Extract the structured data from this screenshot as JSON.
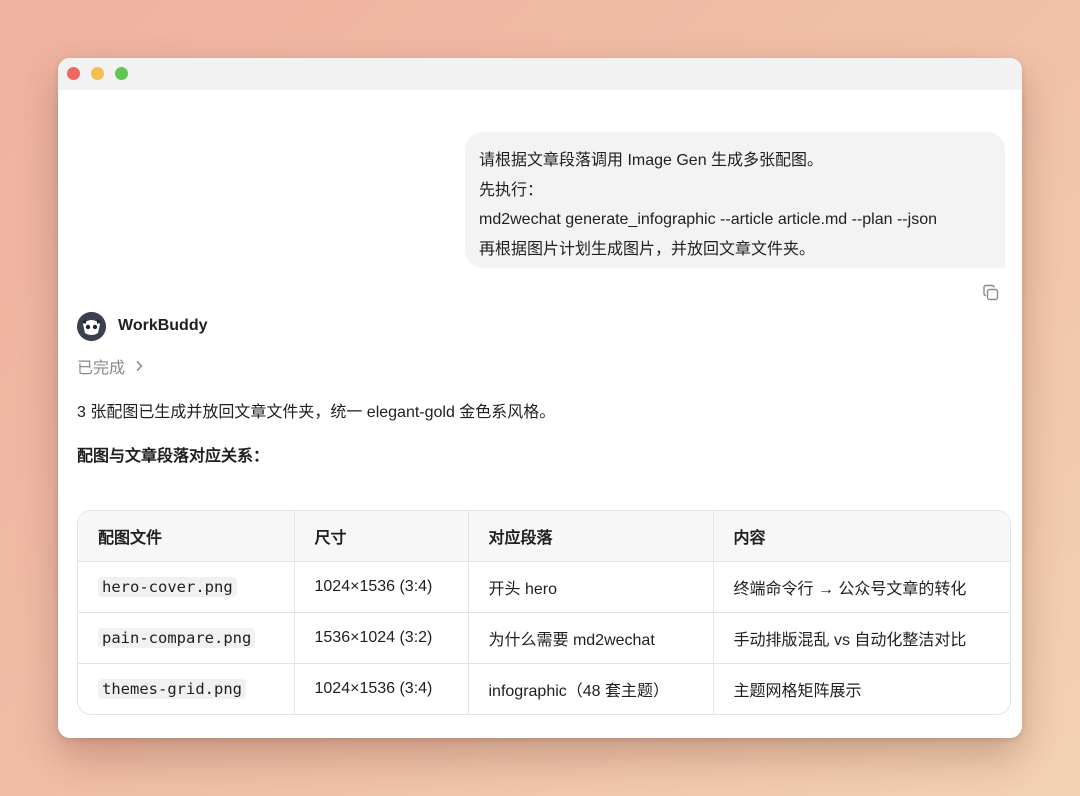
{
  "user_message": {
    "lines": [
      "请根据文章段落调用 Image Gen 生成多张配图。",
      "先执行：",
      "md2wechat generate_infographic --article article.md --plan --json",
      "再根据图片计划生成图片，并放回文章文件夹。"
    ]
  },
  "assistant": {
    "name": "WorkBuddy",
    "status": "已完成",
    "summary": "3 张配图已生成并放回文章文件夹，统一 elegant-gold 金色系风格。",
    "section_heading": "配图与文章段落对应关系："
  },
  "table": {
    "headers": [
      "配图文件",
      "尺寸",
      "对应段落",
      "内容"
    ],
    "rows": [
      [
        "hero-cover.png",
        "1024×1536 (3:4)",
        "开头 hero",
        "终端命令行 → 公众号文章的转化"
      ],
      [
        "pain-compare.png",
        "1536×1024 (3:2)",
        "为什么需要 md2wechat",
        "手动排版混乱 vs 自动化整洁对比"
      ],
      [
        "themes-grid.png",
        "1024×1536 (3:4)",
        "infographic（48 套主题）",
        "主题网格矩阵展示"
      ]
    ]
  },
  "icons": {
    "copy": "copy-icon",
    "chevron": "chevron-right-icon",
    "avatar": "avatar-icon"
  },
  "colors": {
    "traffic_red": "#ee6a5f",
    "traffic_yellow": "#f5bf4f",
    "traffic_green": "#61c554",
    "bubble_bg": "#f3f3f3",
    "avatar_bg": "#3b4150"
  }
}
